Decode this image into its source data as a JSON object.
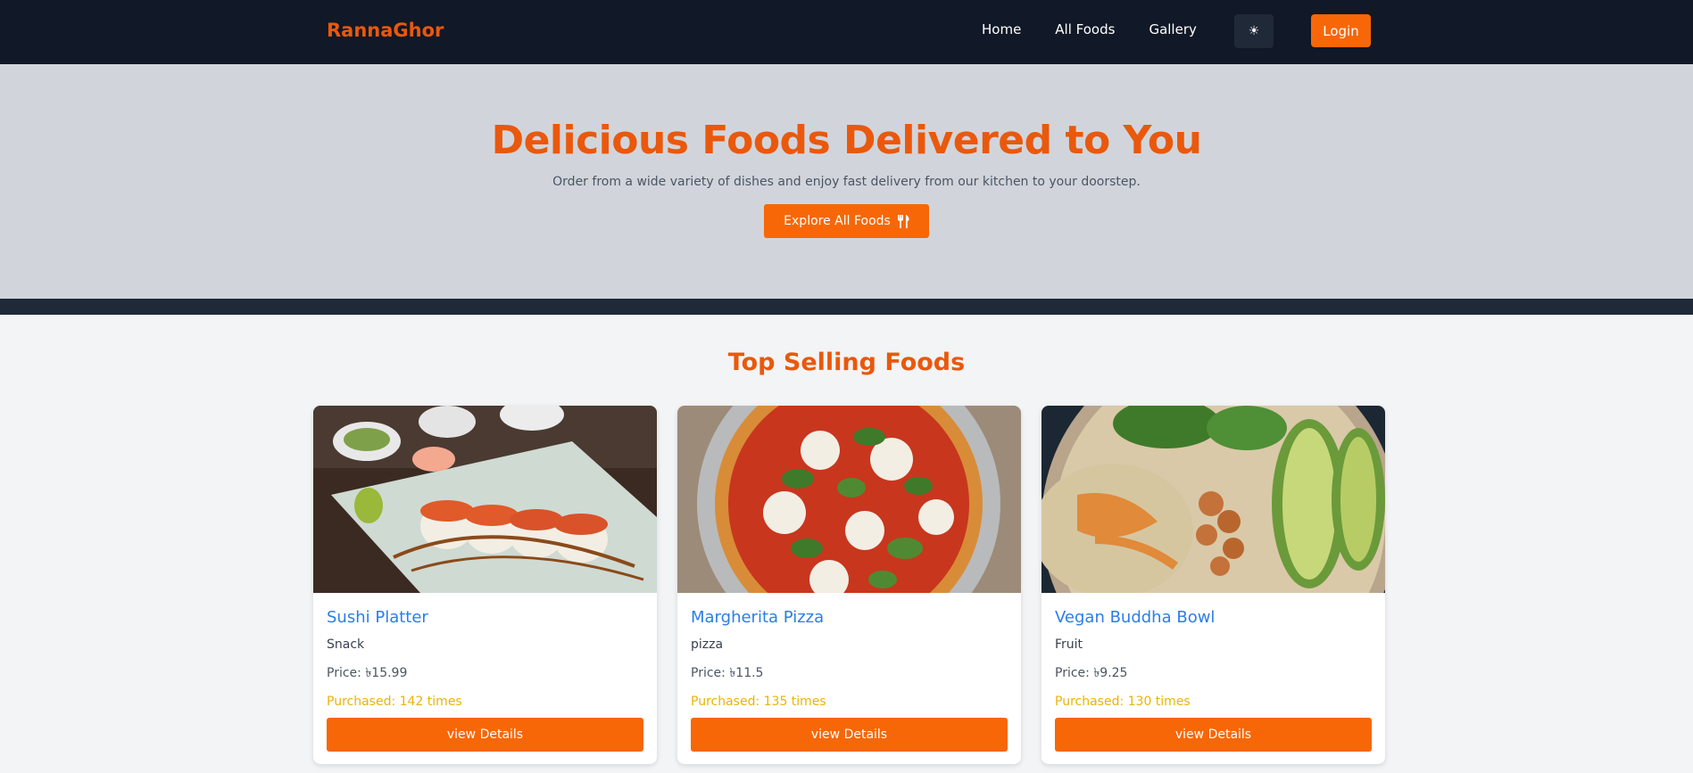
{
  "nav": {
    "brand": "RannaGhor",
    "links": [
      "Home",
      "All Foods",
      "Gallery"
    ],
    "theme_icon": "☀",
    "login_label": "Login"
  },
  "hero": {
    "title": "Delicious Foods Delivered to You",
    "subtitle": "Order from a wide variety of dishes and enjoy fast delivery from our kitchen to your doorstep.",
    "cta_label": "Explore All Foods",
    "cta_icon": "utensils-icon"
  },
  "top_selling": {
    "title": "Top Selling Foods",
    "items": [
      {
        "name": "Sushi Platter",
        "category": "Snack",
        "price": "Price: ৳15.99",
        "purchased": "Purchased: 142 times",
        "button": "view Details"
      },
      {
        "name": "Margherita Pizza",
        "category": "pizza",
        "price": "Price: ৳11.5",
        "purchased": "Purchased: 135 times",
        "button": "view Details"
      },
      {
        "name": "Vegan Buddha Bowl",
        "category": "Fruit",
        "price": "Price: ৳9.25",
        "purchased": "Purchased: 130 times",
        "button": "view Details"
      }
    ]
  },
  "colors": {
    "nav_bg": "#111827",
    "brand": "#ea580c",
    "accent": "#f76707",
    "hero_bg": "#d1d5db",
    "card_title": "#2b7de9",
    "purchased": "#eab308"
  }
}
